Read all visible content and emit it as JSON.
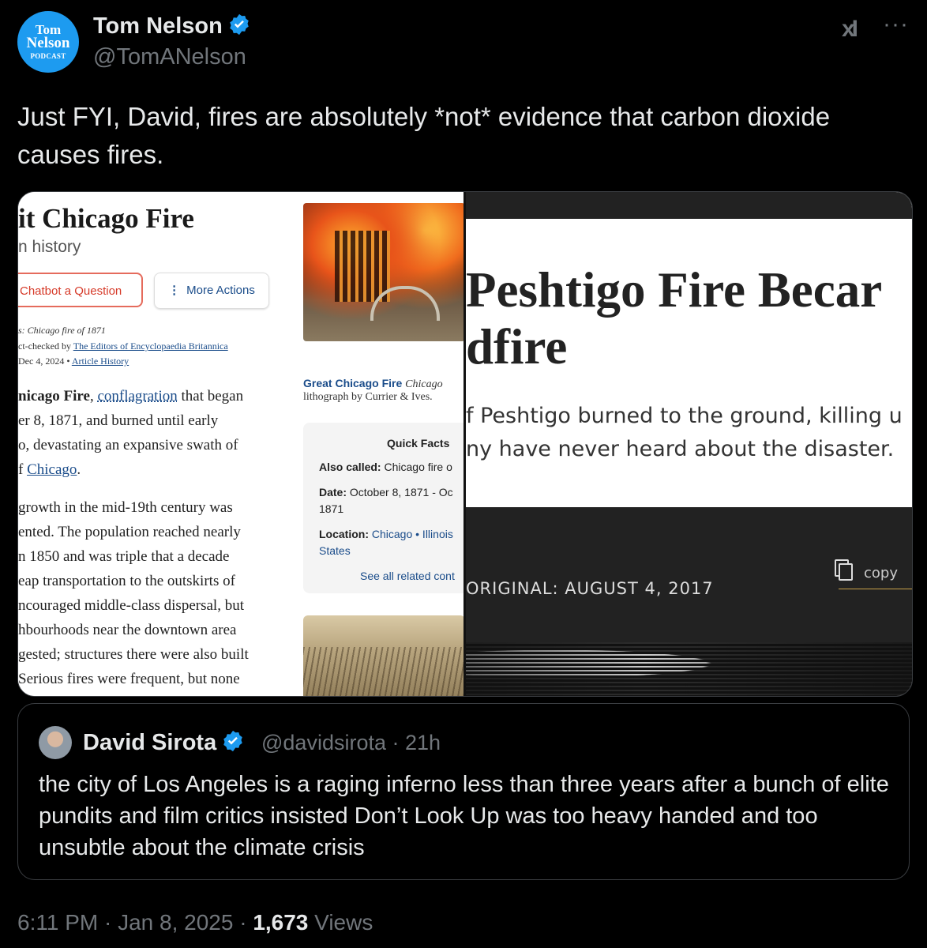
{
  "author": {
    "avatar_lines": [
      "Tom",
      "Nelson",
      "PODCAST"
    ],
    "name": "Tom Nelson",
    "handle": "@TomANelson"
  },
  "header_icons": {
    "grok": "xI",
    "more": "···"
  },
  "tweet_text": "Just FYI, David, fires are absolutely *not* evidence that carbon dioxide causes fires.",
  "media": {
    "left": {
      "title": "it Chicago Fire",
      "subtitle": "n history",
      "btn_chatbot": "Chatbot a Question",
      "btn_more": "More Actions",
      "meta1": "s: Chicago fire of 1871",
      "meta2_prefix": "ct-checked by ",
      "meta2_link": "The Editors of Encyclopaedia Britannica",
      "meta3_prefix": " Dec 4, 2024 • ",
      "meta3_link": "Article History",
      "body": [
        {
          "pre": "",
          "b": "nicago Fire",
          "mid": ", ",
          "link": "conflagration",
          "post": " that began"
        },
        {
          "pre": "er 8, 1871, and burned until early"
        },
        {
          "pre": "o, devastating an expansive swath of"
        },
        {
          "pre": "f ",
          "link": "Chicago",
          "post": "."
        },
        {
          "pre": " growth in the mid-19th century was"
        },
        {
          "pre": "ented. The population reached nearly"
        },
        {
          "pre": "n 1850 and was triple that a decade"
        },
        {
          "pre": "eap transportation to the outskirts of"
        },
        {
          "pre": "ncouraged middle-class dispersal, but"
        },
        {
          "pre": "hbourhoods near the downtown area"
        },
        {
          "pre": "gested; structures there were also built"
        },
        {
          "pre": "Serious fires were frequent, but none"
        }
      ],
      "caption_title": "Great Chicago Fire",
      "caption_italic": "Chicago",
      "caption_sub": "lithograph by Currier & Ives.",
      "quick_facts": {
        "heading": "Quick Facts",
        "also_label": "Also called:",
        "also_value": "Chicago fire o",
        "date_label": "Date:",
        "date_value": "October 8, 1871 - Oc",
        "date_value2": "1871",
        "loc_label": "Location:",
        "loc_value": "Chicago • Illinois",
        "loc_value2": "States",
        "see_all": "See all related cont"
      }
    },
    "right": {
      "title_line1": "Peshtigo Fire Becar",
      "title_line2": "dfire",
      "body_line1": "f Peshtigo burned to the ground, killing u",
      "body_line2": "ny have never heard about the disaster.",
      "original": "ORIGINAL: AUGUST 4, 2017",
      "copy": "copy"
    }
  },
  "quote": {
    "name": "David Sirota",
    "handle": "@davidsirota · 21h",
    "text": "the city of Los Angeles is a raging inferno less than three years after a bunch of elite pundits and film critics insisted Don’t Look Up was too heavy handed and too unsubtle about the climate crisis"
  },
  "footer": {
    "time": "6:11 PM · Jan 8, 2025 · ",
    "views_count": "1,673",
    "views_label": " Views"
  },
  "colors": {
    "verified": "#1d9bf0",
    "link": "#1a4c8a",
    "muted": "#71767b"
  }
}
